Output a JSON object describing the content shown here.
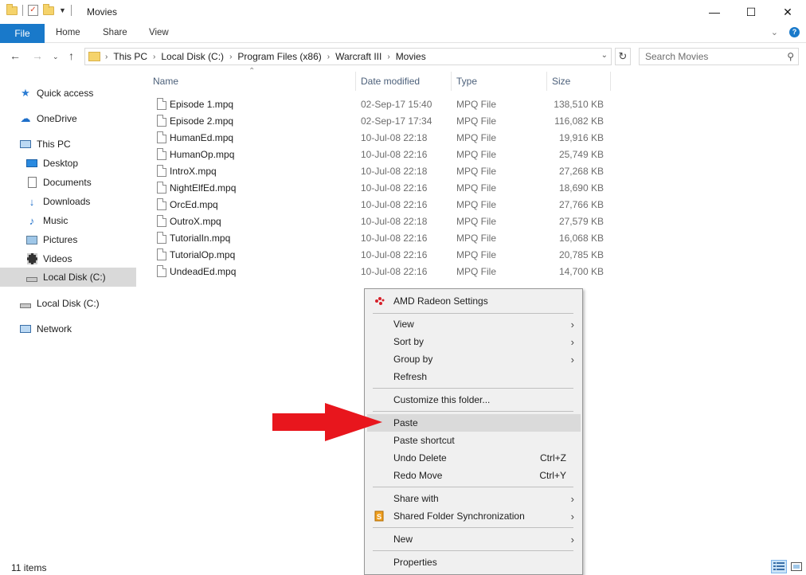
{
  "window": {
    "title": "Movies",
    "minimize": "—",
    "maximize": "☐",
    "close": "✕"
  },
  "ribbon": {
    "tabs": [
      "File",
      "Home",
      "Share",
      "View"
    ]
  },
  "address": {
    "crumbs": [
      "This PC",
      "Local Disk (C:)",
      "Program Files (x86)",
      "Warcraft III",
      "Movies"
    ]
  },
  "search": {
    "placeholder": "Search Movies"
  },
  "sidebar": {
    "items": [
      {
        "label": "Quick access",
        "icon": "star-icon"
      },
      {
        "label": "OneDrive",
        "icon": "cloud-icon"
      },
      {
        "label": "This PC",
        "icon": "computer-icon"
      },
      {
        "label": "Desktop",
        "icon": "desktop-icon"
      },
      {
        "label": "Documents",
        "icon": "documents-icon"
      },
      {
        "label": "Downloads",
        "icon": "download-icon"
      },
      {
        "label": "Music",
        "icon": "music-icon"
      },
      {
        "label": "Pictures",
        "icon": "pictures-icon"
      },
      {
        "label": "Videos",
        "icon": "videos-icon"
      },
      {
        "label": "Local Disk (C:)",
        "icon": "drive-icon",
        "selected": true
      },
      {
        "label": "Local Disk (C:)",
        "icon": "drive-icon"
      },
      {
        "label": "Network",
        "icon": "network-icon"
      }
    ]
  },
  "columns": {
    "name": "Name",
    "date": "Date modified",
    "type": "Type",
    "size": "Size"
  },
  "files": [
    {
      "name": "Episode 1.mpq",
      "date": "02-Sep-17 15:40",
      "type": "MPQ File",
      "size": "138,510 KB"
    },
    {
      "name": "Episode 2.mpq",
      "date": "02-Sep-17 17:34",
      "type": "MPQ File",
      "size": "116,082 KB"
    },
    {
      "name": "HumanEd.mpq",
      "date": "10-Jul-08 22:18",
      "type": "MPQ File",
      "size": "19,916 KB"
    },
    {
      "name": "HumanOp.mpq",
      "date": "10-Jul-08 22:16",
      "type": "MPQ File",
      "size": "25,749 KB"
    },
    {
      "name": "IntroX.mpq",
      "date": "10-Jul-08 22:18",
      "type": "MPQ File",
      "size": "27,268 KB"
    },
    {
      "name": "NightElfEd.mpq",
      "date": "10-Jul-08 22:16",
      "type": "MPQ File",
      "size": "18,690 KB"
    },
    {
      "name": "OrcEd.mpq",
      "date": "10-Jul-08 22:16",
      "type": "MPQ File",
      "size": "27,766 KB"
    },
    {
      "name": "OutroX.mpq",
      "date": "10-Jul-08 22:18",
      "type": "MPQ File",
      "size": "27,579 KB"
    },
    {
      "name": "TutorialIn.mpq",
      "date": "10-Jul-08 22:16",
      "type": "MPQ File",
      "size": "16,068 KB"
    },
    {
      "name": "TutorialOp.mpq",
      "date": "10-Jul-08 22:16",
      "type": "MPQ File",
      "size": "20,785 KB"
    },
    {
      "name": "UndeadEd.mpq",
      "date": "10-Jul-08 22:16",
      "type": "MPQ File",
      "size": "14,700 KB"
    }
  ],
  "context_menu": {
    "items": [
      {
        "label": "AMD Radeon Settings",
        "icon": "amd-radeon-icon"
      },
      {
        "label": "View",
        "submenu": true
      },
      {
        "label": "Sort by",
        "submenu": true
      },
      {
        "label": "Group by",
        "submenu": true
      },
      {
        "label": "Refresh"
      },
      {
        "label": "Customize this folder..."
      },
      {
        "label": "Paste",
        "highlighted": true
      },
      {
        "label": "Paste shortcut"
      },
      {
        "label": "Undo Delete",
        "shortcut": "Ctrl+Z"
      },
      {
        "label": "Redo Move",
        "shortcut": "Ctrl+Y"
      },
      {
        "label": "Share with",
        "submenu": true
      },
      {
        "label": "Shared Folder Synchronization",
        "icon": "sync-s-icon",
        "submenu": true
      },
      {
        "label": "New",
        "submenu": true
      },
      {
        "label": "Properties"
      }
    ]
  },
  "status": {
    "item_count": "11 items"
  },
  "colors": {
    "accent": "#1979ca",
    "arrow": "#e8161d",
    "selection": "#d9d9d9"
  }
}
